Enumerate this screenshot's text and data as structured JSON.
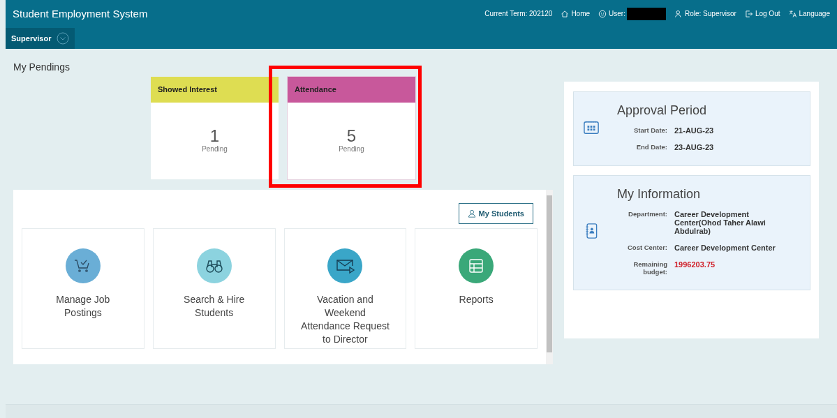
{
  "header": {
    "title": "Student Employment System",
    "term": "Current Term: 202120",
    "home": "Home",
    "user_label": "User:",
    "user_redacted": true,
    "role": "Role: Supervisor",
    "logout": "Log Out",
    "language": "Language"
  },
  "nav": {
    "tab": "Supervisor"
  },
  "pendings": {
    "title": "My Pendings",
    "tiles": [
      {
        "label": "Showed Interest",
        "count": "1",
        "caption": "Pending",
        "color": "#dedd52",
        "highlighted": false
      },
      {
        "label": "Attendance",
        "count": "5",
        "caption": "Pending",
        "color": "#c8589b",
        "highlighted": true
      }
    ]
  },
  "actions": {
    "button": "My Students",
    "cards": [
      {
        "kind": "cart",
        "label": "Manage Job Postings",
        "color": "#6aaed6"
      },
      {
        "kind": "binoculars",
        "label": "Search & Hire Students",
        "color": "#8cd3df"
      },
      {
        "kind": "mail",
        "label": "Vacation and Weekend Attendance Request to Director",
        "color": "#3aa6c8"
      },
      {
        "kind": "table",
        "label": "Reports",
        "color": "#3aa879"
      }
    ]
  },
  "approval": {
    "title": "Approval Period",
    "rows": [
      {
        "label": "Start Date:",
        "value": "21-AUG-23"
      },
      {
        "label": "End Date:",
        "value": "23-AUG-23"
      }
    ]
  },
  "info": {
    "title": "My Information",
    "rows": [
      {
        "label": "Department:",
        "value": "Career Development Center(Ohod Taher Alawi Abdulrab)",
        "alert": false
      },
      {
        "label": "Cost Center:",
        "value": "Career Development Center",
        "alert": false
      },
      {
        "label": "Remaining budget:",
        "value": "1996203.75",
        "alert": true
      }
    ]
  }
}
